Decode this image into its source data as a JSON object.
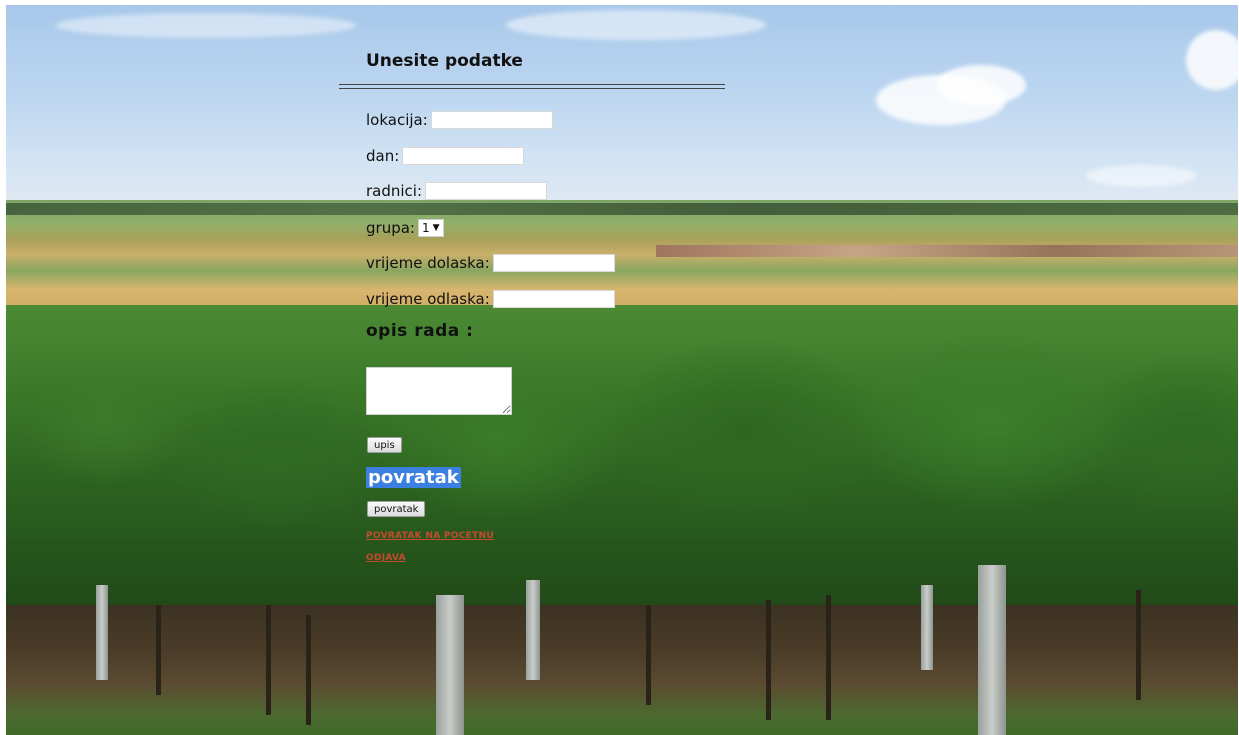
{
  "form": {
    "heading": "Unesite podatke",
    "fields": [
      {
        "label": "lokacija:",
        "value": ""
      },
      {
        "label": "dan:",
        "value": ""
      },
      {
        "label": "radnici:",
        "value": ""
      }
    ],
    "group": {
      "label": "grupa:",
      "selected": "1"
    },
    "arrival": {
      "label": "vrijeme dolaska:",
      "value": ""
    },
    "departure": {
      "label": "vrijeme odlaska:",
      "value": ""
    },
    "description_heading": "opis rada :",
    "description_value": "",
    "submit_label": "upis",
    "back_heading": "povratak",
    "back_button_label": "povratak",
    "links": [
      {
        "label": "POVRATAK NA POCETNU"
      },
      {
        "label": "ODJAVA"
      }
    ]
  },
  "theme": {
    "link_color": "#c64b2e",
    "highlight_color": "#3b7fe0"
  }
}
